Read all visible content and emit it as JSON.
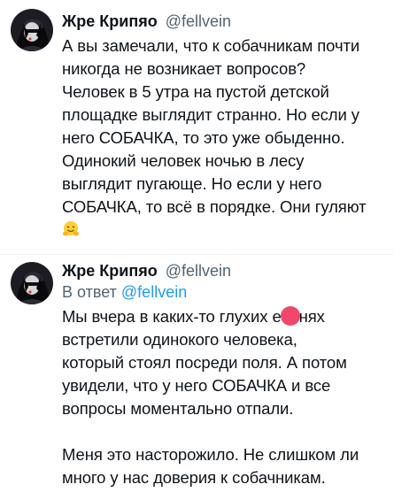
{
  "tweets": [
    {
      "display_name": "Жре Крипяо",
      "handle": "@fellvein",
      "lines": [
        "А вы замечали, что к собачникам почти",
        "никогда не возникает вопросов?",
        "Человек в 5 утра на пустой детской",
        "площадке выглядит странно. Но если у",
        "него СОБАЧКА, то это уже обыденно.",
        "Одинокий человек ночью в лесу",
        "выглядит пугающе. Но если у него",
        "СОБАЧКА, то всё в порядке. Они гуляют"
      ],
      "emoji": "hugging-face-emoji"
    },
    {
      "display_name": "Жре Крипяо",
      "handle": "@fellvein",
      "reply_prefix": "В ответ",
      "reply_handle": "@fellvein",
      "line1_before": "Мы вчера в каких-то глухих е",
      "line1_after": "нях",
      "lines": [
        "встретили одинокого человека,",
        "который стоял посреди поля. А потом",
        "увидели, что у него СОБАЧКА и все",
        "вопросы моментально отпали."
      ],
      "lines2": [
        "Меня это насторожило. Не слишком ли",
        "много у нас доверия к собачникам."
      ]
    }
  ],
  "colors": {
    "text": "#0f1419",
    "secondary": "#536471",
    "link": "#1d9bf0",
    "overlay_dot": "#f0476a"
  }
}
